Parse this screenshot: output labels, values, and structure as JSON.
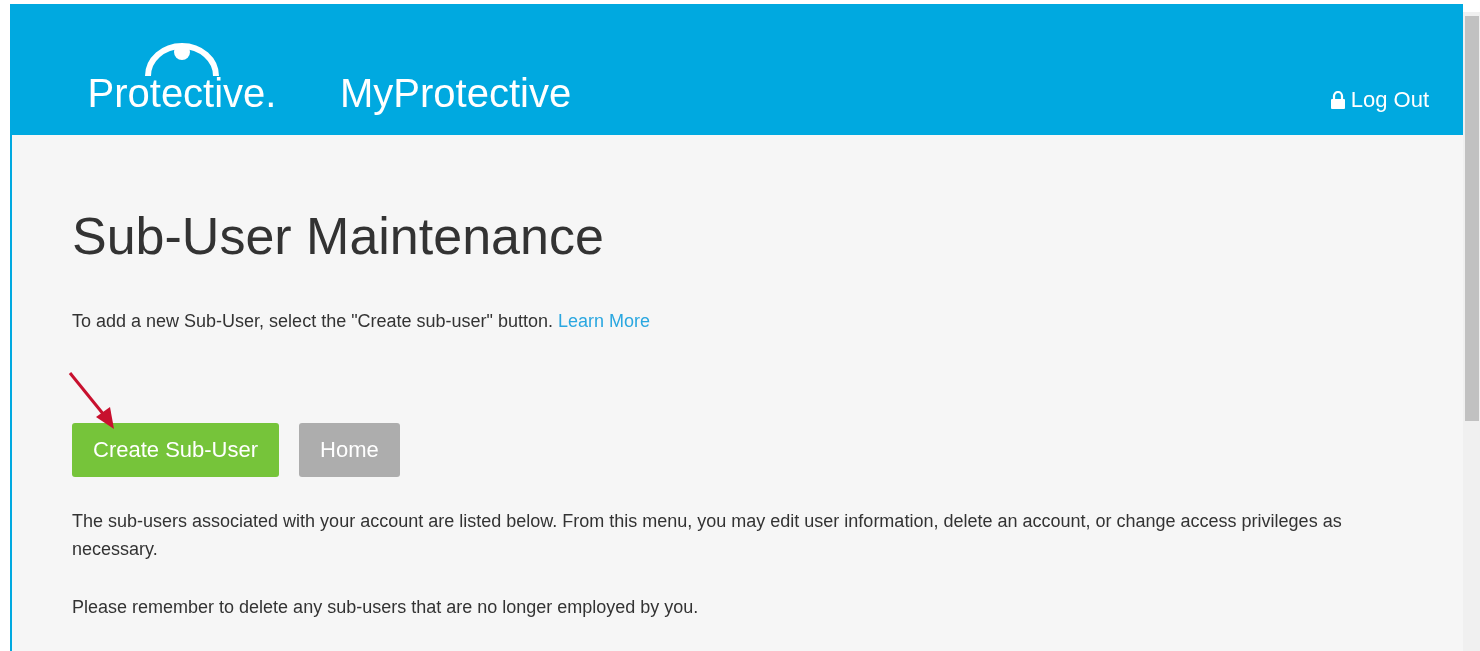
{
  "header": {
    "logo": "Protective.",
    "app_name": "MyProtective",
    "logout": "Log Out"
  },
  "page": {
    "title": "Sub-User Maintenance",
    "intro": "To add a new Sub-User, select the \"Create sub-user\" button.",
    "intro_link": "Learn More",
    "buttons": [
      {
        "label": "Create Sub-User",
        "kind": "primary"
      },
      {
        "label": "Home",
        "kind": "secondary"
      }
    ],
    "paragraphs": [
      "The sub-users associated with your account are listed below. From this menu, you may edit user information, delete an account, or change access privileges as necessary.",
      "Please remember to delete any sub-users that are no longer employed by you."
    ]
  }
}
